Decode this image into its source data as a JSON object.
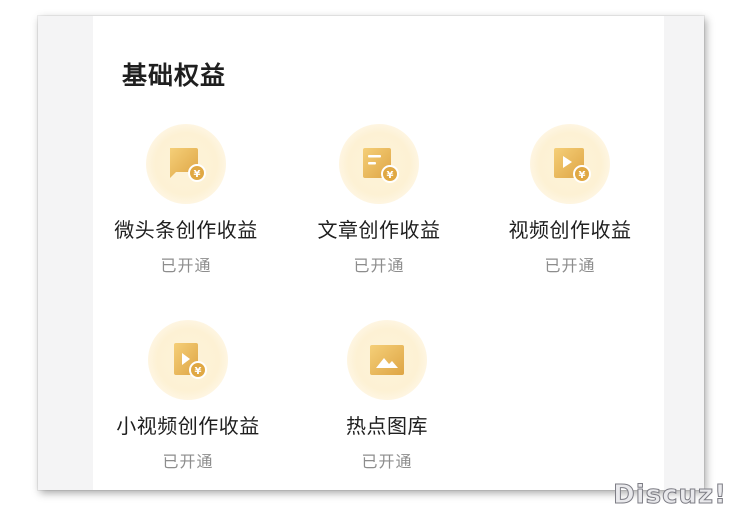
{
  "section": {
    "title": "基础权益"
  },
  "benefits": [
    {
      "label": "微头条创作收益",
      "status": "已开通",
      "icon": "chat-bubble-yuan-icon"
    },
    {
      "label": "文章创作收益",
      "status": "已开通",
      "icon": "article-yuan-icon"
    },
    {
      "label": "视频创作收益",
      "status": "已开通",
      "icon": "video-yuan-icon"
    },
    {
      "label": "小视频创作收益",
      "status": "已开通",
      "icon": "short-video-yuan-icon"
    },
    {
      "label": "热点图库",
      "status": "已开通",
      "icon": "image-gallery-icon"
    }
  ],
  "watermark": "Discuz!",
  "colors": {
    "icon_gold_light": "#f3c76a",
    "icon_gold_dark": "#dba446",
    "halo": "#fdf2d6",
    "text_primary": "#1f1f1f",
    "text_secondary": "#8d8d8d"
  }
}
